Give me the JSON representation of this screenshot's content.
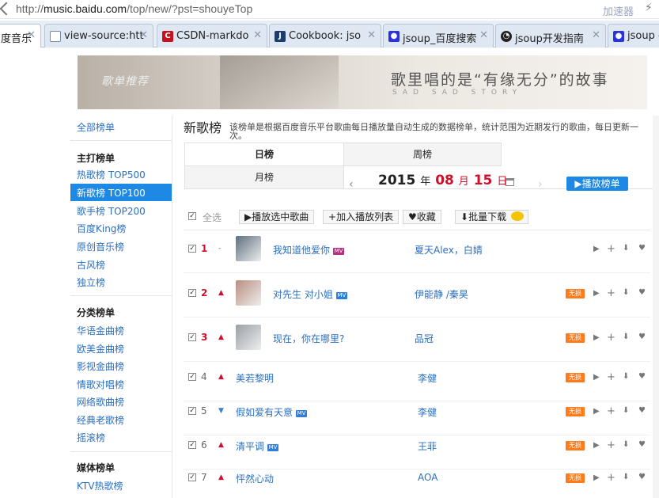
{
  "browser": {
    "url_prefix": "http://",
    "url_host": "music.baidu.com",
    "url_path": "/top/new/?pst=shouyeTop",
    "accelerator_label": "加速器",
    "tabs": [
      {
        "label": "度音乐",
        "icon": "baidu-music-icon",
        "active": true
      },
      {
        "label": "view-source:htt",
        "icon": "document-icon"
      },
      {
        "label": "CSDN-markdo",
        "icon": "csdn-icon"
      },
      {
        "label": "Cookbook: jso",
        "icon": "jsoup-icon"
      },
      {
        "label": "jsoup_百度搜索",
        "icon": "baidu-paw-icon"
      },
      {
        "label": "jsoup开发指南",
        "icon": "github-icon"
      },
      {
        "label": "jsoup c",
        "icon": "baidu-paw-icon"
      }
    ]
  },
  "banner": {
    "tag": "歌单推荐",
    "tagline": "歌里唱的是“有缘无分”的故事",
    "sub": "SAD SAD STORY"
  },
  "sidebar": {
    "all": "全部榜单",
    "groups": [
      {
        "heading": "主打榜单",
        "items": [
          "热歌榜 TOP500",
          "新歌榜 TOP100",
          "歌手榜 TOP200",
          "百度King榜",
          "原创音乐榜",
          "古风榜",
          "独立榜"
        ]
      },
      {
        "heading": "分类榜单",
        "items": [
          "华语金曲榜",
          "欧美金曲榜",
          "影视金曲榜",
          "情歌对唱榜",
          "网络歌曲榜",
          "经典老歌榜",
          "摇滚榜"
        ]
      },
      {
        "heading": "媒体榜单",
        "items": [
          "KTV热歌榜"
        ]
      }
    ],
    "selected": "新歌榜 TOP100"
  },
  "main": {
    "title": "新歌榜",
    "description": "该榜单是根据百度音乐平台歌曲每日播放量自动生成的数据榜单，统计范围为近期发行的歌曲，每日更新一次。",
    "period_tabs": [
      "日榜",
      "周榜",
      "月榜"
    ],
    "date": {
      "year": "2015",
      "year_unit": "年",
      "month": "08",
      "month_unit": "月",
      "day": "15",
      "day_unit": "日"
    },
    "play_list_label": "播放榜单",
    "toolbar": {
      "select_all": "全选",
      "play_selected": "播放选中歌曲",
      "add_to_playlist": "加入播放列表",
      "favorite": "收藏",
      "batch_download": "批量下载"
    },
    "lossless_label": "无损",
    "songs": [
      {
        "rank": "1",
        "trend": "-",
        "title": "我知道他爱你",
        "badge": "MV",
        "artist": "夏天Alex，白婧",
        "lossless": false,
        "thumb": true
      },
      {
        "rank": "2",
        "trend": "▲",
        "title": "对先生 对小姐",
        "badge": "MV",
        "artist": "伊能静 /秦昊",
        "lossless": true,
        "thumb": true
      },
      {
        "rank": "3",
        "trend": "▲",
        "title": "现在，你在哪里?",
        "badge": "",
        "artist": "品冠",
        "lossless": true,
        "thumb": true
      },
      {
        "rank": "4",
        "trend": "▲",
        "title": "美若黎明",
        "badge": "",
        "artist": "李健",
        "lossless": true,
        "thumb": false
      },
      {
        "rank": "5",
        "trend": "▼",
        "title": "假如爱有天意",
        "badge": "MV",
        "artist": "李健",
        "lossless": true,
        "thumb": false
      },
      {
        "rank": "6",
        "trend": "▲",
        "title": "清平调",
        "badge": "MV",
        "artist": "王菲",
        "lossless": true,
        "thumb": false
      },
      {
        "rank": "7",
        "trend": "▲",
        "title": "怦然心动",
        "badge": "",
        "artist": "AOA",
        "lossless": true,
        "thumb": false
      }
    ]
  },
  "colors": {
    "accent": "#1e88e5",
    "rank_top": "#d0102a",
    "lossless": "#ff7b1c",
    "link": "#2a6fc0"
  }
}
